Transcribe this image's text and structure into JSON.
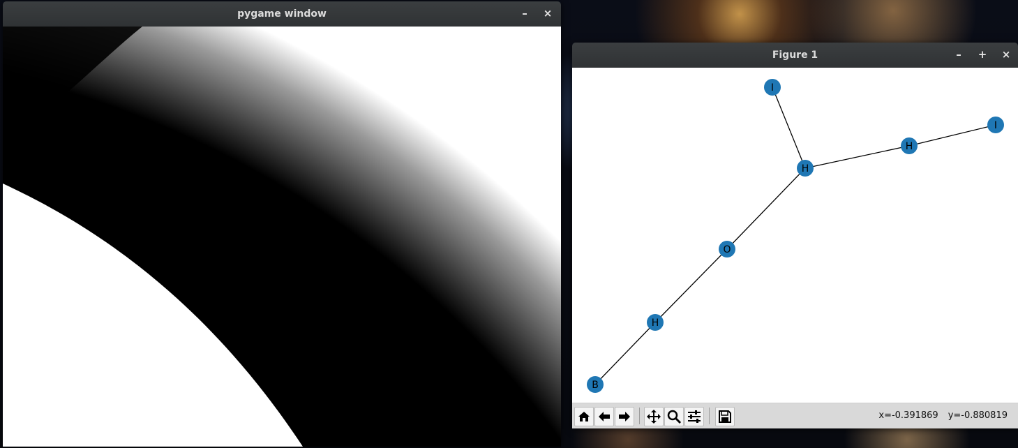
{
  "pygame_window": {
    "title": "pygame window",
    "controls": {
      "minimize": "–",
      "close": "×"
    }
  },
  "figure_window": {
    "title": "Figure 1",
    "controls": {
      "minimize": "–",
      "maximize": "+",
      "close": "×"
    },
    "graph": {
      "nodes": [
        {
          "id": "n1",
          "label": "I"
        },
        {
          "id": "n2",
          "label": "I"
        },
        {
          "id": "n3",
          "label": "H"
        },
        {
          "id": "n4",
          "label": "H"
        },
        {
          "id": "n5",
          "label": "O"
        },
        {
          "id": "n6",
          "label": "H"
        },
        {
          "id": "n7",
          "label": "B"
        }
      ],
      "edges": [
        [
          "n1",
          "n4"
        ],
        [
          "n4",
          "n3"
        ],
        [
          "n3",
          "n2"
        ],
        [
          "n4",
          "n5"
        ],
        [
          "n5",
          "n6"
        ],
        [
          "n6",
          "n7"
        ]
      ],
      "node_color": "#1f77b4",
      "edge_color": "#000000"
    },
    "toolbar": {
      "tools": [
        "home-icon",
        "back-icon",
        "forward-icon",
        "pan-icon",
        "zoom-icon",
        "configure-subplots-icon",
        "save-icon"
      ],
      "coords": {
        "x": "x=-0.391869",
        "y": "y=-0.880819"
      }
    }
  }
}
